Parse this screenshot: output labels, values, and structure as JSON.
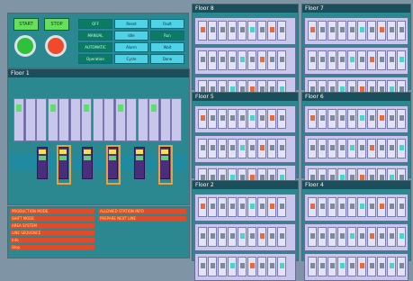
{
  "control": {
    "start": "START",
    "stop": "STOP",
    "grid": [
      "OFF",
      "Reset",
      "Fault",
      "MANUAL",
      "Idle",
      "Run",
      "AUTOMATIC",
      "Alarm",
      "Wait",
      "Operation",
      "Cycle",
      "Done"
    ]
  },
  "floors": [
    {
      "title": "Floor 8",
      "id": "floor-8"
    },
    {
      "title": "Floor 7",
      "id": "floor-7"
    },
    {
      "title": "Floor 5",
      "id": "floor-5"
    },
    {
      "title": "Floor 6",
      "id": "floor-6"
    },
    {
      "title": "Floor 2",
      "id": "floor-2"
    },
    {
      "title": "Floor 4",
      "id": "floor-4"
    }
  ],
  "line": {
    "title": "Floor 1"
  },
  "bottom": {
    "red1": "PRODUCTION MODE",
    "red2": "SHIFT MODE",
    "red3": "AREA SYSTEM",
    "red4": "LINE SEQUENCE",
    "red5": "Info",
    "red6": "Stop",
    "right1": "ALLOWED STATION INFO",
    "right2": "PREPARE NEXT LINE"
  }
}
